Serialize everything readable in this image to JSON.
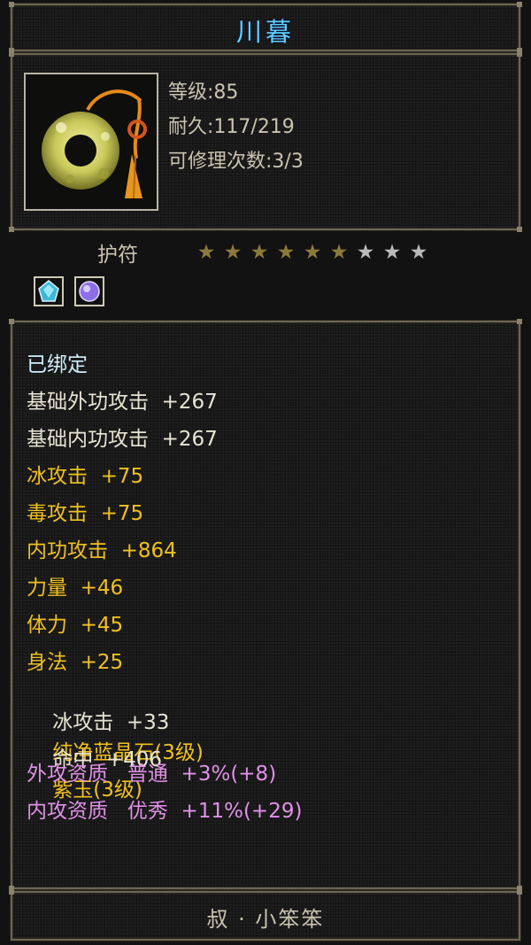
{
  "title": "川暮",
  "item_icon": "jade-pendant-icon",
  "info": {
    "level": "等级:85",
    "durability": "耐久:117/219",
    "repairs": "可修理次数:3/3"
  },
  "type_label": "护符",
  "stars": {
    "filled": 6,
    "total": 9,
    "filled_color": "#8c7a3c",
    "empty_color": "#b9b9b9"
  },
  "gems": [
    {
      "name": "blue-crystal-gem-icon",
      "color": "#3fb8d8"
    },
    {
      "name": "purple-jade-gem-icon",
      "color": "#8c6ee8"
    }
  ],
  "colors": {
    "title": "#5fd0ff",
    "bound": "#cfeefa",
    "base": "#e8e4d4",
    "bonus": "#f0c020",
    "quality": "#e090e8"
  },
  "stats": [
    {
      "text": "已绑定",
      "tone": "bound"
    },
    {
      "text": "基础外功攻击  +267",
      "tone": "base"
    },
    {
      "text": "基础内功攻击  +267",
      "tone": "base"
    },
    {
      "text": "冰攻击  +75",
      "tone": "bonus"
    },
    {
      "text": "毒攻击  +75",
      "tone": "bonus"
    },
    {
      "text": "内功攻击  +864",
      "tone": "bonus"
    },
    {
      "text": "力量  +46",
      "tone": "bonus"
    },
    {
      "text": "体力  +45",
      "tone": "bonus"
    },
    {
      "text": "身法  +25",
      "tone": "bonus"
    },
    {
      "text": "冰攻击  +33",
      "tone": "base",
      "extra": "纯净蓝晶石(3级)"
    },
    {
      "text": "命中  +406",
      "tone": "base",
      "extra": "紫玉(3级)"
    },
    {
      "text": "外攻资质   普通  +3%(+8)",
      "tone": "quality"
    },
    {
      "text": "内攻资质   优秀  +11%(+29)",
      "tone": "quality"
    }
  ],
  "footer": "叔 · 小笨笨"
}
